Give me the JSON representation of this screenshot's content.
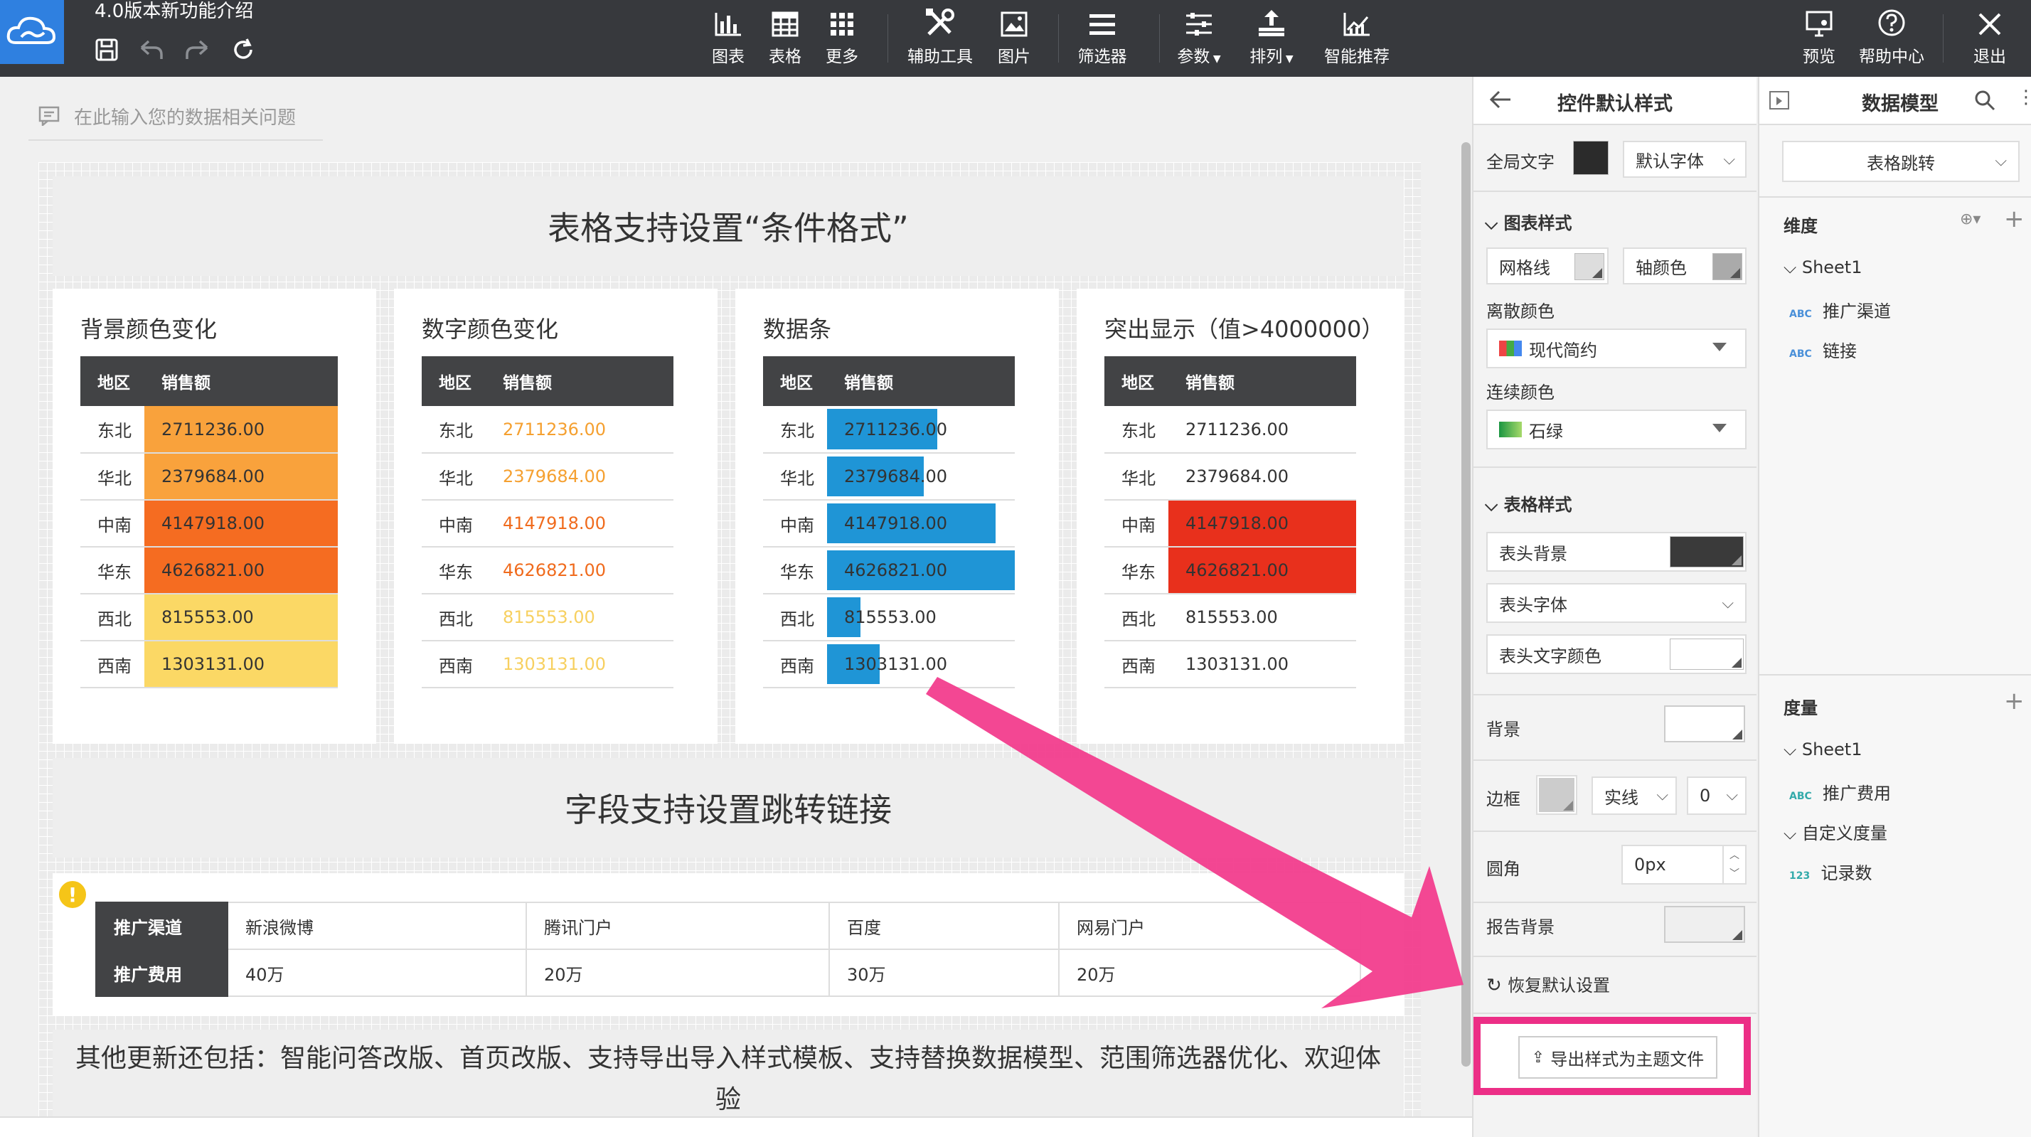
{
  "topbar": {
    "title": "4.0版本新功能介绍",
    "tools": [
      {
        "label": "图表",
        "icon": "bar-chart-icon"
      },
      {
        "label": "表格",
        "icon": "table-icon"
      },
      {
        "label": "更多",
        "icon": "grid-more-icon"
      },
      {
        "label": "辅助工具",
        "icon": "tools-icon"
      },
      {
        "label": "图片",
        "icon": "image-icon"
      },
      {
        "label": "筛选器",
        "icon": "filter-list-icon"
      },
      {
        "label": "参数",
        "icon": "params-icon"
      },
      {
        "label": "排列",
        "icon": "arrange-icon"
      },
      {
        "label": "智能推荐",
        "icon": "smart-recommend-icon"
      }
    ],
    "right_tools": [
      {
        "label": "预览",
        "icon": "preview-icon"
      },
      {
        "label": "帮助中心",
        "icon": "help-icon"
      },
      {
        "label": "退出",
        "icon": "close-icon"
      }
    ]
  },
  "qa": {
    "placeholder": "在此输入您的数据相关问题"
  },
  "report": {
    "banner1": "表格支持设置“条件格式”",
    "banner2": "字段支持设置跳转链接",
    "footer": "其他更新还包括：智能问答改版、首页改版、支持导出导入样式模板、支持替换数据模型、范围筛选器优化、欢迎体验",
    "col_region": "地区",
    "col_sales": "销售额",
    "cards": [
      {
        "title": "背景颜色变化"
      },
      {
        "title": "数字颜色变化"
      },
      {
        "title": "数据条"
      },
      {
        "title": "突出显示（值>4000000）"
      }
    ],
    "rows": [
      {
        "region": "东北",
        "sales": "2711236.00",
        "value": 2711236.0
      },
      {
        "region": "华北",
        "sales": "2379684.00",
        "value": 2379684.0
      },
      {
        "region": "中南",
        "sales": "4147918.00",
        "value": 4147918.0
      },
      {
        "region": "华东",
        "sales": "4626821.00",
        "value": 4626821.0
      },
      {
        "region": "西北",
        "sales": "815553.00",
        "value": 815553.0
      },
      {
        "region": "西南",
        "sales": "1303131.00",
        "value": 1303131.0
      }
    ],
    "bg_colors": [
      "#f9a23c",
      "#f9a23c",
      "#f56c21",
      "#f56c21",
      "#fbd865",
      "#fbd865"
    ],
    "num_colors": [
      "#f5a030",
      "#f5a030",
      "#f06b1d",
      "#f06b1d",
      "#f7d060",
      "#f7d060"
    ],
    "highlight_color": "#e8301c",
    "link_table": {
      "row1": [
        "推广渠道",
        "新浪微博",
        "腾讯门户",
        "百度",
        "网易门户"
      ],
      "row2": [
        "推广费用",
        "40万",
        "20万",
        "30万",
        "20万"
      ]
    }
  },
  "style_panel": {
    "title": "控件默认样式",
    "global_text": "全局文字",
    "default_font": "默认字体",
    "chart_style": "图表样式",
    "gridline": "网格线",
    "axis_color": "轴颜色",
    "discrete_color": "离散颜色",
    "discrete_value": "现代简约",
    "continuous_color": "连续颜色",
    "continuous_value": "石绿",
    "table_style": "表格样式",
    "header_bg": "表头背景",
    "header_font": "表头字体",
    "header_text_color": "表头文字颜色",
    "background": "背景",
    "border": "边框",
    "border_style": "实线",
    "border_width": "0",
    "radius": "圆角",
    "radius_value": "0px",
    "report_bg": "报告背景",
    "reset": "恢复默认设置",
    "export": "导出样式为主题文件"
  },
  "model_panel": {
    "title": "数据模型",
    "selected": "表格跳转",
    "dimension": "维度",
    "measure": "度量",
    "dim_sheet": "Sheet1",
    "dim_fields": [
      "推广渠道",
      "链接"
    ],
    "measure_sheet": "Sheet1",
    "measure_fields": [
      "推广费用"
    ],
    "custom_measure": "自定义度量",
    "custom_fields": [
      "记录数"
    ],
    "abc": "ABC",
    "num": "123"
  },
  "colors": {
    "accent": "#ec2e86",
    "topbar": "#37393d",
    "header": "#424345",
    "databar": "#1f95d6"
  }
}
